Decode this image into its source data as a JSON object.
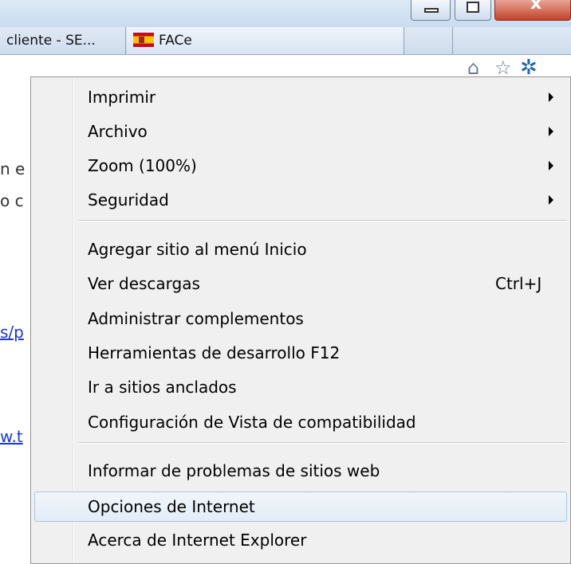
{
  "tabs": [
    {
      "label": "cliente - SE..."
    },
    {
      "label": "FACe"
    }
  ],
  "toolbar_icons": [
    "home-icon",
    "star-icon",
    "gear-icon"
  ],
  "page_fragments": {
    "line1": "n e",
    "line2": "o c",
    "link1": "s/p",
    "link2": "w.t"
  },
  "menu": {
    "items": [
      {
        "label": "Imprimir",
        "submenu": true
      },
      {
        "label": "Archivo",
        "submenu": true
      },
      {
        "label": "Zoom (100%)",
        "submenu": true
      },
      {
        "label": "Seguridad",
        "submenu": true
      },
      {
        "label": "Agregar sitio al menú Inicio"
      },
      {
        "label": "Ver descargas",
        "shortcut": "Ctrl+J"
      },
      {
        "label": "Administrar complementos"
      },
      {
        "label": "Herramientas de desarrollo F12"
      },
      {
        "label": "Ir a sitios anclados"
      },
      {
        "label": "Configuración de Vista de compatibilidad"
      },
      {
        "label": "Informar de problemas de sitios web"
      },
      {
        "label": "Opciones de Internet",
        "highlighted": true
      },
      {
        "label": "Acerca de Internet Explorer"
      }
    ]
  },
  "colors": {
    "menu_bg": "#f0f0f0",
    "highlight_border": "#a9c4e6",
    "link": "#1a37d8",
    "close_button": "#c2432a"
  }
}
